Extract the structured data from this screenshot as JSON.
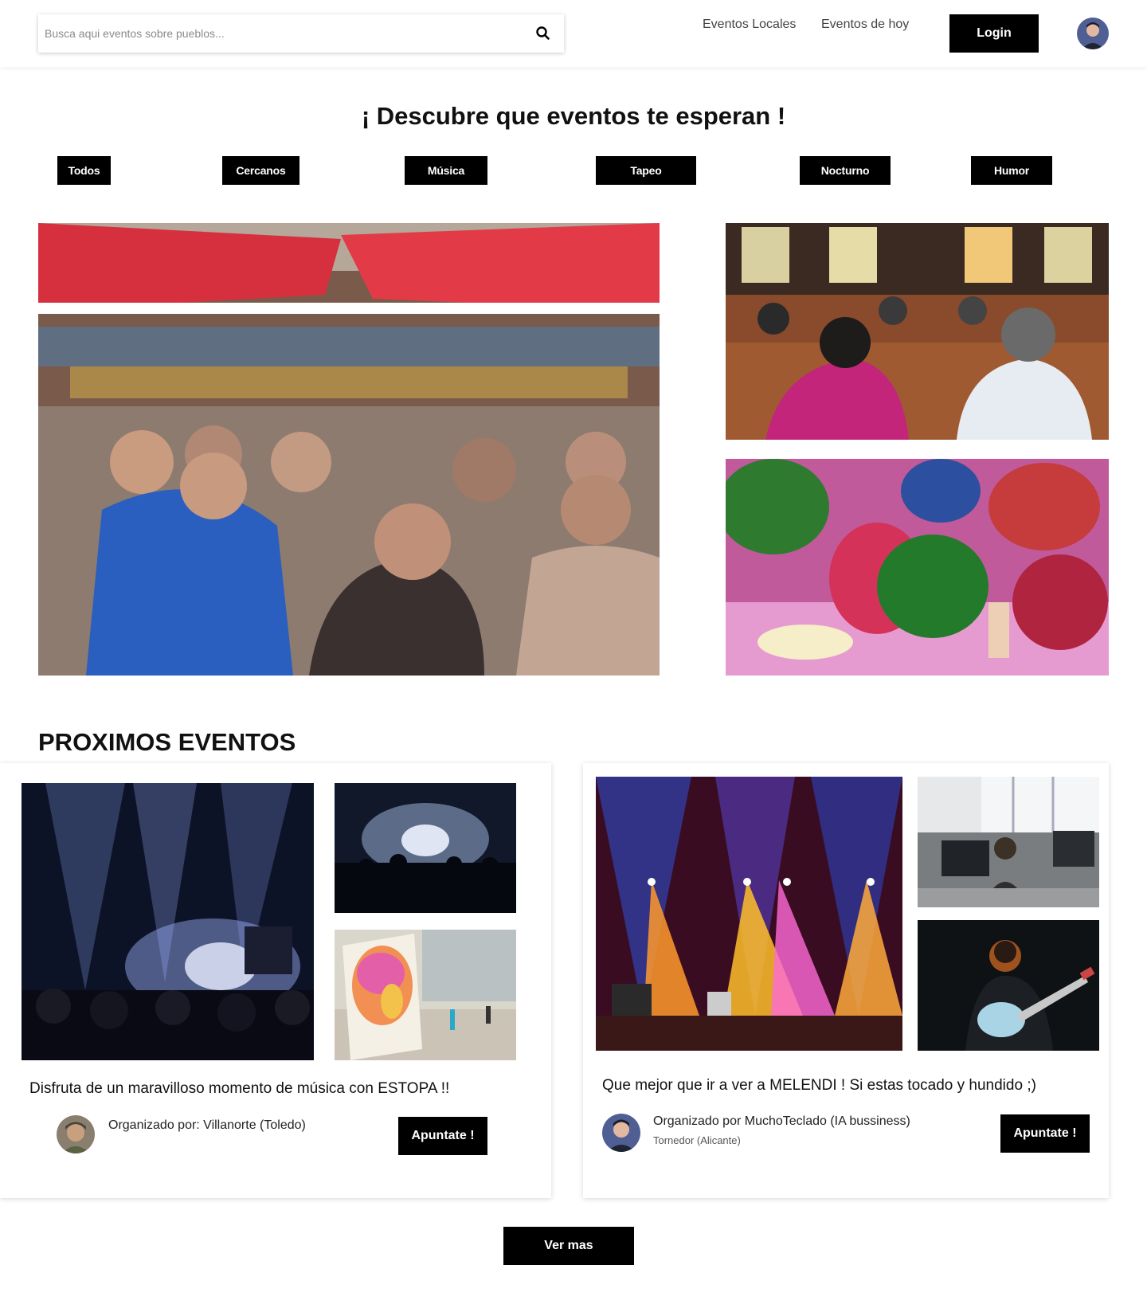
{
  "header": {
    "search_placeholder": "Busca aqui eventos sobre pueblos...",
    "nav_links": [
      "Eventos Locales",
      "Eventos de hoy"
    ],
    "login_label": "Login"
  },
  "hero": {
    "title": "¡ Descubre que eventos te esperan !",
    "categories": [
      "Todos",
      "Cercanos",
      "Música",
      "Tapeo",
      "Nocturno",
      "Humor"
    ]
  },
  "events": {
    "section_title": "PROXIMOS EVENTOS",
    "items": [
      {
        "title": "Disfruta de un maravilloso momento de música con ESTOPA !!",
        "organizer": "Organizado por: Villanorte (Toledo)",
        "button": "Apuntate !"
      },
      {
        "title": "Que mejor que ir a ver a MELENDI ! Si estas tocado y hundido ;)",
        "organizer": "Organizado por MuchoTeclado (IA bussiness)",
        "location": "Tornedor (Alicante)",
        "button": "Apuntate !"
      }
    ],
    "more_label": "Ver mas"
  },
  "colors": {
    "primary": "#000000",
    "background": "#ffffff",
    "text": "#111111"
  }
}
